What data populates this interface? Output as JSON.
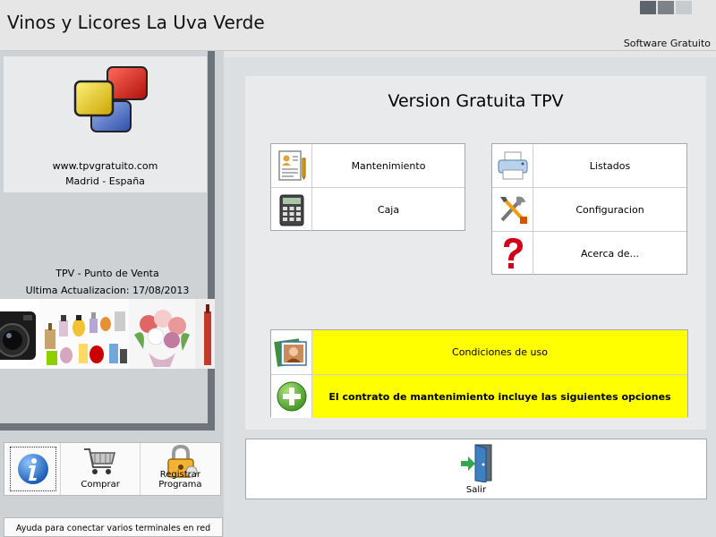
{
  "header": {
    "title": "Vinos y Licores La Uva Verde",
    "subtitle": "Software Gratuito",
    "window_squares": [
      "#5d636a",
      "#7c8288",
      "#c8cbce"
    ]
  },
  "left": {
    "logo_alt": "tpvgratuito-logo",
    "website": "www.tpvgratuito.com",
    "city": "Madrid - España",
    "product": "TPV - Punto de Venta",
    "last_update": "Ultima Actualizacion: 17/08/2013",
    "toolbar": [
      {
        "label": "",
        "icon": "info-icon"
      },
      {
        "label": "Comprar",
        "icon": "shopping-cart-icon"
      },
      {
        "label": "Registrar Programa",
        "icon": "padlock-icon"
      }
    ],
    "help_text": "Ayuda para conectar varios terminales en red"
  },
  "main": {
    "title": "Version Gratuita TPV",
    "left_buttons": [
      {
        "label": "Mantenimiento",
        "icon": "document-icon"
      },
      {
        "label": "Caja",
        "icon": "calculator-icon"
      }
    ],
    "right_buttons": [
      {
        "label": "Listados",
        "icon": "printer-icon"
      },
      {
        "label": "Configuracion",
        "icon": "tools-icon"
      },
      {
        "label": "Acerca de...",
        "icon": "question-icon"
      }
    ],
    "yellow_buttons": [
      {
        "label": "Condiciones de uso",
        "icon": "photo-icon"
      },
      {
        "label": "El contrato de mantenimiento incluye las siguientes opciones",
        "icon": "add-icon"
      }
    ],
    "exit_label": "Salir",
    "accent_yellow": "#ffff00",
    "panel_border": "#6d747b"
  }
}
